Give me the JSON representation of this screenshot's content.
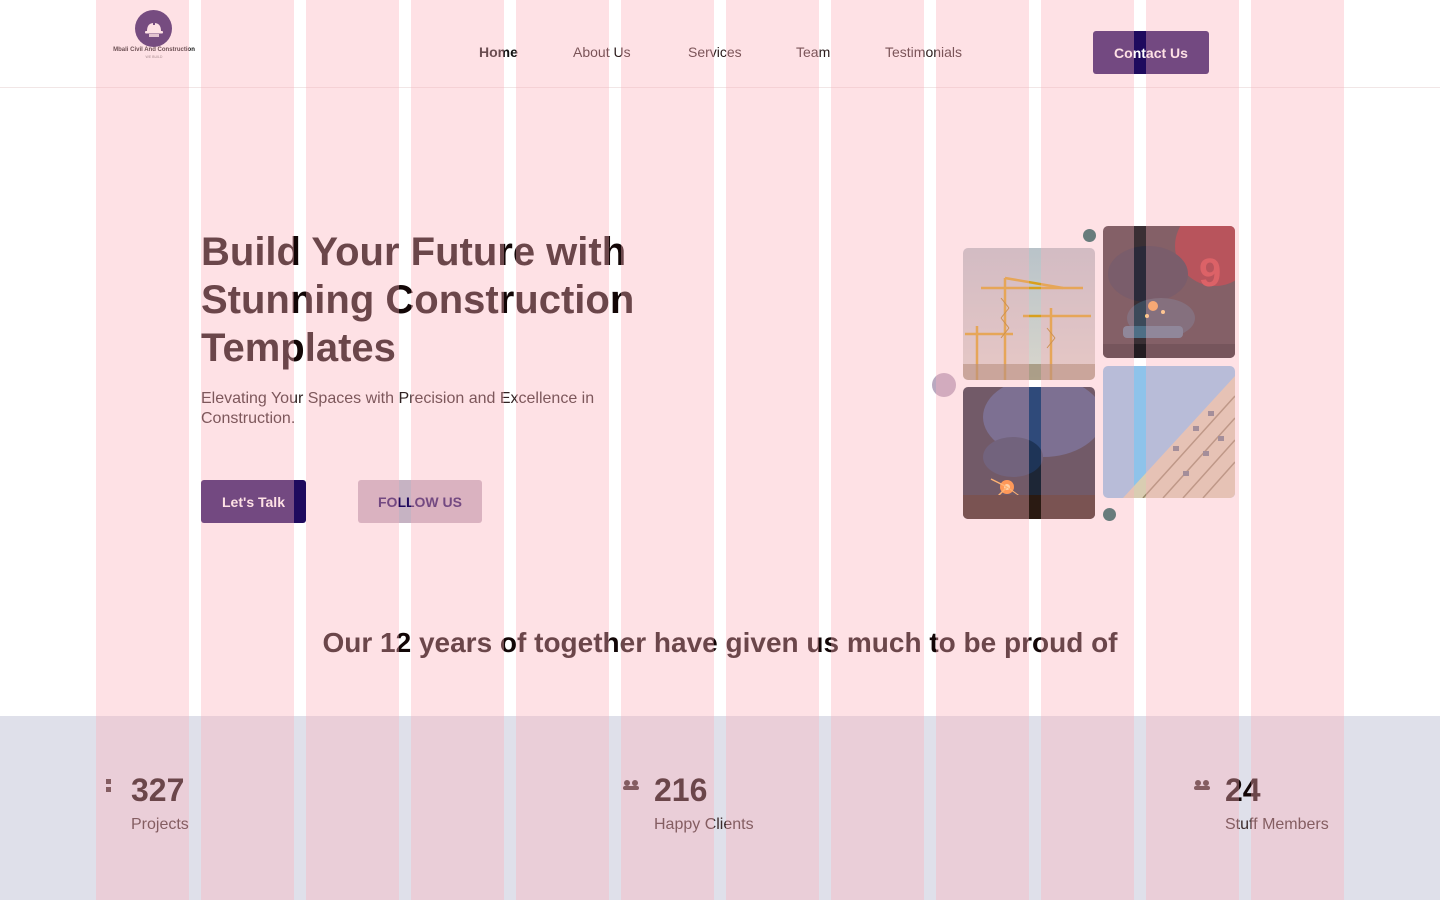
{
  "brand": {
    "name": "Mbali Civil And Construction",
    "tagline": "WE BUILD"
  },
  "nav": {
    "items": [
      {
        "label": "Home",
        "active": true
      },
      {
        "label": "About Us",
        "active": false
      },
      {
        "label": "Services",
        "active": false
      },
      {
        "label": "Team",
        "active": false
      },
      {
        "label": "Testimonials",
        "active": false
      }
    ],
    "contact_label": "Contact Us"
  },
  "hero": {
    "title_line1": "Build Your Future with",
    "title_line2": "Stunning Construction",
    "title_line3": "Templates",
    "subtitle": "Elevating Your Spaces with Precision and Excellence in Construction.",
    "primary_cta": "Let's Talk",
    "secondary_cta": "FOLLOW US",
    "images": [
      {
        "name": "tower-cranes-photo"
      },
      {
        "name": "worker-grinding-photo"
      },
      {
        "name": "welding-sparks-photo"
      },
      {
        "name": "building-facade-photo"
      }
    ]
  },
  "tagline": "Our 12 years of together have given us much to be proud of",
  "stats": [
    {
      "icon": "projects-icon",
      "value": "327",
      "label": "Projects"
    },
    {
      "icon": "clients-icon",
      "value": "216",
      "label": "Happy Clients"
    },
    {
      "icon": "members-icon",
      "value": "24",
      "label": "Stuff Members"
    }
  ],
  "colors": {
    "primary": "#1f0a5e",
    "secondary_button": "#c6b3c3",
    "stats_band": "#dfe0ea",
    "grid_overlay": "#fdb0ba",
    "accent_dot": "#0e5c56"
  }
}
